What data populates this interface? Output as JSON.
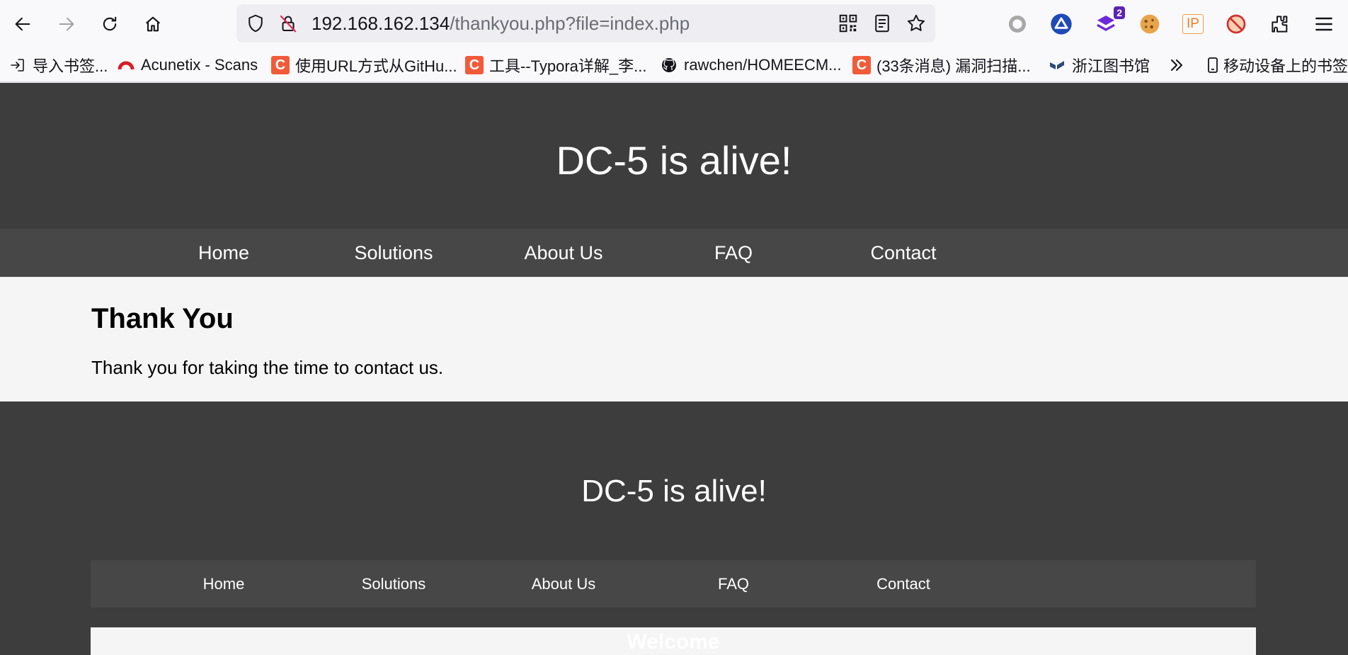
{
  "browser": {
    "url_host": "192.168.162.134",
    "url_path": "/thankyou.php?file=index.php",
    "extension_badge": "2",
    "extension_ip": "IP"
  },
  "bookmarks": [
    {
      "label": "导入书签...",
      "icon": "import-icon"
    },
    {
      "label": "Acunetix - Scans",
      "icon": "acunetix-icon"
    },
    {
      "label": "使用URL方式从GitHu...",
      "icon": "csdn-icon"
    },
    {
      "label": "工具--Typora详解_李...",
      "icon": "csdn-icon"
    },
    {
      "label": "rawchen/HOMEECM...",
      "icon": "github-icon"
    },
    {
      "label": "(33条消息) 漏洞扫描...",
      "icon": "csdn-icon"
    },
    {
      "label": "浙江图书馆",
      "icon": "library-icon"
    },
    {
      "label": "移动设备上的书签",
      "icon": "mobile-icon"
    }
  ],
  "page": {
    "site_title": "DC-5 is alive!",
    "nav": [
      "Home",
      "Solutions",
      "About Us",
      "FAQ",
      "Contact"
    ],
    "heading": "Thank You",
    "message": "Thank you for taking the time to contact us.",
    "footer_title": "DC-5 is alive!",
    "footer_nav": [
      "Home",
      "Solutions",
      "About Us",
      "FAQ",
      "Contact"
    ],
    "welcome": "Welcome"
  },
  "colors": {
    "header_bg": "#3d3d3d",
    "nav_bg": "#474747",
    "content_bg": "#f5f5f5",
    "csdn_red": "#f15b3a"
  }
}
